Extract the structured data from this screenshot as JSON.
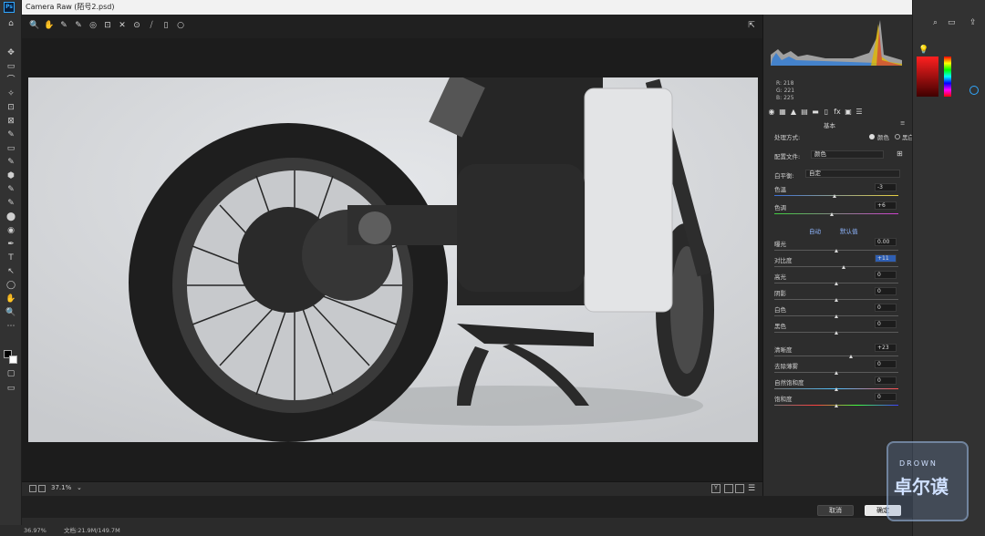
{
  "dialog": {
    "title": "Camera Raw (陌号2.psd)"
  },
  "ps": {
    "logo": "Ps",
    "zoom_status": "36.97%",
    "doc_status": "文档:21.9M/149.7M"
  },
  "crtools": [
    "🔍",
    "✋",
    "✎",
    "✎",
    "◎",
    "⊡",
    "✕",
    "⊙",
    "⧸",
    "▯",
    "○"
  ],
  "pstools": [
    "✥",
    "▭",
    "⌒",
    "✧",
    "⊡",
    "⊠",
    "✎",
    "▭",
    "✎",
    "⬢",
    "✎",
    "✎",
    "⬤",
    "◉",
    "✒",
    "T",
    "↖",
    "◯",
    "✋",
    "🔍",
    "⋯"
  ],
  "histogram": {
    "r_label": "R:",
    "g_label": "G:",
    "b_label": "B:",
    "r": "218",
    "g": "221",
    "b": "225"
  },
  "panel": {
    "section_title": "基本",
    "treatment_label": "处理方式:",
    "treatment_color": "颜色",
    "treatment_bw": "黑白",
    "profile_label": "配置文件:",
    "profile_value": "颜色",
    "wb_label": "白平衡:",
    "wb_value": "自定",
    "auto_label": "自动",
    "default_label": "默认值",
    "sliders": [
      {
        "label": "色温",
        "value": "-3",
        "pos": 0.49
      },
      {
        "label": "色调",
        "value": "+6",
        "pos": 0.47
      },
      {
        "label": "曝光",
        "value": "0.00",
        "pos": 0.5
      },
      {
        "label": "对比度",
        "value": "+11",
        "pos": 0.56
      },
      {
        "label": "高光",
        "value": "0",
        "pos": 0.5
      },
      {
        "label": "阴影",
        "value": "0",
        "pos": 0.5
      },
      {
        "label": "白色",
        "value": "0",
        "pos": 0.5
      },
      {
        "label": "黑色",
        "value": "0",
        "pos": 0.5
      },
      {
        "label": "清晰度",
        "value": "+23",
        "pos": 0.62
      },
      {
        "label": "去除薄雾",
        "value": "0",
        "pos": 0.5
      },
      {
        "label": "自然饱和度",
        "value": "0",
        "pos": 0.5
      },
      {
        "label": "饱和度",
        "value": "0",
        "pos": 0.5
      }
    ]
  },
  "bottom": {
    "zoom": "37.1%",
    "cancel": "取消",
    "ok": "确定"
  },
  "watermark": {
    "brand": "DROWN",
    "name": "卓尔谟"
  }
}
